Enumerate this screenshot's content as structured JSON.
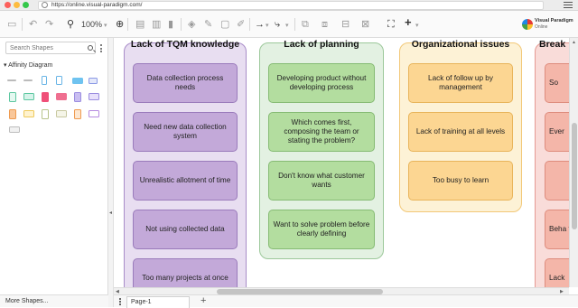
{
  "browser": {
    "url": "https://online.visual-paradigm.com/"
  },
  "toolbar": {
    "zoom": "100%",
    "brand_name": "Visual Paradigm",
    "brand_sub": "Online"
  },
  "left_panel": {
    "search_placeholder": "Search Shapes",
    "category": "Affinity Diagram",
    "more_shapes": "More Shapes..."
  },
  "pages": {
    "current": "Page-1",
    "add_label": "+"
  },
  "columns": [
    {
      "title": "Lack of TQM knowledge",
      "color": "#e8def1",
      "notes": [
        "Data collection process needs",
        "Need new data collection system",
        "Unrealistic allotment of time",
        "Not using collected data",
        "Too many projects at once"
      ]
    },
    {
      "title": "Lack of planning",
      "color": "#e3f1e2",
      "notes": [
        "Developing product without developing process",
        "Which comes first, composing the team or stating the problem?",
        "Don't know what customer wants",
        "Want to solve problem before clearly defining"
      ]
    },
    {
      "title": "Organizational issues",
      "color": "#fdf2d6",
      "notes": [
        "Lack of follow up by management",
        "Lack of training at all levels",
        "Too busy to learn"
      ]
    },
    {
      "title": "Break",
      "color": "#f9dcd9",
      "notes": [
        "So",
        "Ever",
        "",
        "Beha ta",
        "Lack"
      ]
    }
  ]
}
